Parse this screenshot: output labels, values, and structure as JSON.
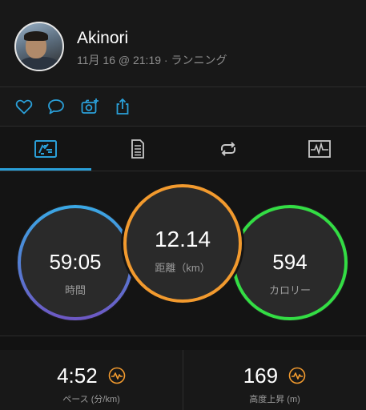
{
  "header": {
    "user_name": "Akinori",
    "activity_meta": "11月 16 @ 21:19 · ランニング"
  },
  "actions": {
    "icons": [
      "heart-icon",
      "comment-icon",
      "add-photo-icon",
      "share-icon"
    ]
  },
  "tabs": {
    "items": [
      "overview-tab-icon",
      "details-tab-icon",
      "laps-tab-icon",
      "chart-tab-icon"
    ],
    "active_index": 0
  },
  "circles": {
    "time": {
      "value": "59:05",
      "label": "時間"
    },
    "distance": {
      "value": "12.14",
      "label": "距離（km）"
    },
    "calories": {
      "value": "594",
      "label": "カロリー"
    }
  },
  "stats": {
    "pace": {
      "value": "4:52",
      "label": "ペース (分/km)"
    },
    "elevation": {
      "value": "169",
      "label": "高度上昇 (m)"
    }
  },
  "colors": {
    "background": "#121212",
    "accent_blue": "#2a9fd8",
    "ring_time_start": "#3aa7e4",
    "ring_time_end": "#6d58c4",
    "ring_distance": "#f29a2e",
    "ring_calories": "#33dd44",
    "pulse_icon": "#f29a2e"
  }
}
